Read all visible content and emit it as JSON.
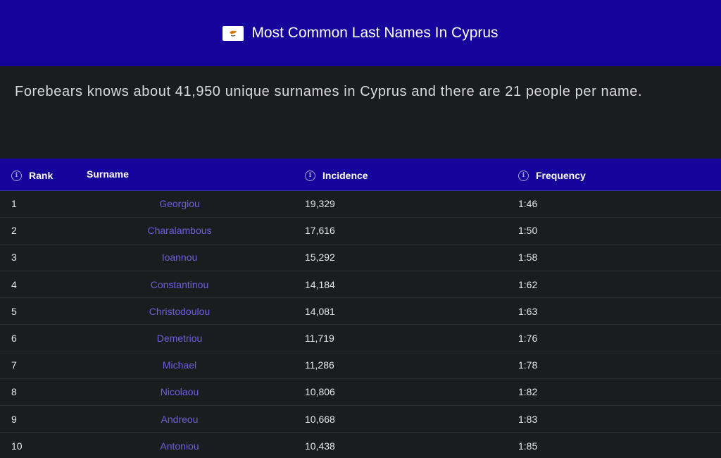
{
  "header": {
    "title": "Most Common Last Names In Cyprus",
    "flag_icon": "cyprus-flag-icon"
  },
  "intro": {
    "text": "Forebears knows about 41,950 unique surnames in Cyprus and there are 21 people per name."
  },
  "table": {
    "columns": {
      "rank": "Rank",
      "surname": "Surname",
      "incidence": "Incidence",
      "frequency": "Frequency"
    },
    "rows": [
      {
        "rank": "1",
        "surname": "Georgiou",
        "incidence": "19,329",
        "frequency": "1:46"
      },
      {
        "rank": "2",
        "surname": "Charalambous",
        "incidence": "17,616",
        "frequency": "1:50"
      },
      {
        "rank": "3",
        "surname": "Ioannou",
        "incidence": "15,292",
        "frequency": "1:58"
      },
      {
        "rank": "4",
        "surname": "Constantinou",
        "incidence": "14,184",
        "frequency": "1:62"
      },
      {
        "rank": "5",
        "surname": "Christodoulou",
        "incidence": "14,081",
        "frequency": "1:63"
      },
      {
        "rank": "6",
        "surname": "Demetriou",
        "incidence": "11,719",
        "frequency": "1:76"
      },
      {
        "rank": "7",
        "surname": "Michael",
        "incidence": "11,286",
        "frequency": "1:78"
      },
      {
        "rank": "8",
        "surname": "Nicolaou",
        "incidence": "10,806",
        "frequency": "1:82"
      },
      {
        "rank": "9",
        "surname": "Andreou",
        "incidence": "10,668",
        "frequency": "1:83"
      },
      {
        "rank": "10",
        "surname": "Antoniou",
        "incidence": "10,438",
        "frequency": "1:85"
      }
    ]
  },
  "colors": {
    "header_bg": "#15039c",
    "page_bg": "#1b1c1e",
    "link": "#6d5fe0"
  }
}
